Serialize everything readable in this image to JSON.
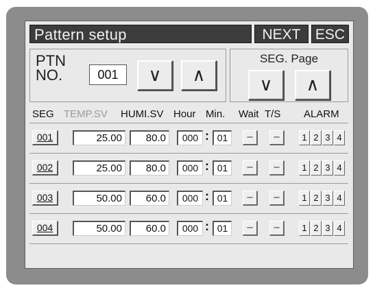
{
  "header": {
    "title": "Pattern setup",
    "next_label": "NEXT",
    "esc_label": "ESC"
  },
  "pattern": {
    "label_line1": "PTN",
    "label_line2": "NO.",
    "value": "001",
    "down_label": "∨",
    "up_label": "∧"
  },
  "seg_page": {
    "label": "SEG. Page",
    "down_label": "∨",
    "up_label": "∧"
  },
  "columns": {
    "seg": "SEG",
    "temp": "TEMP.SV",
    "humi": "HUMI.SV",
    "hour": "Hour",
    "min": "Min.",
    "wait": "Wait",
    "ts": "T/S",
    "alarm": "ALARM"
  },
  "rows": [
    {
      "seg": "001",
      "temp": "25.00",
      "humi": "80.0",
      "hour": "000",
      "min": "01",
      "wait": "–",
      "ts": "–",
      "alarms": [
        "1",
        "2",
        "3",
        "4"
      ]
    },
    {
      "seg": "002",
      "temp": "25.00",
      "humi": "80.0",
      "hour": "000",
      "min": "01",
      "wait": "–",
      "ts": "–",
      "alarms": [
        "1",
        "2",
        "3",
        "4"
      ]
    },
    {
      "seg": "003",
      "temp": "50.00",
      "humi": "60.0",
      "hour": "000",
      "min": "01",
      "wait": "–",
      "ts": "–",
      "alarms": [
        "1",
        "2",
        "3",
        "4"
      ]
    },
    {
      "seg": "004",
      "temp": "50.00",
      "humi": "60.0",
      "hour": "000",
      "min": "01",
      "wait": "–",
      "ts": "–",
      "alarms": [
        "1",
        "2",
        "3",
        "4"
      ]
    }
  ],
  "time_separator": ":",
  "colors": {
    "bezel": "#8c8c8c",
    "screen": "#e9e9e9",
    "title_bar": "#3c3c3c",
    "dim_header": "#9a9a9a"
  }
}
